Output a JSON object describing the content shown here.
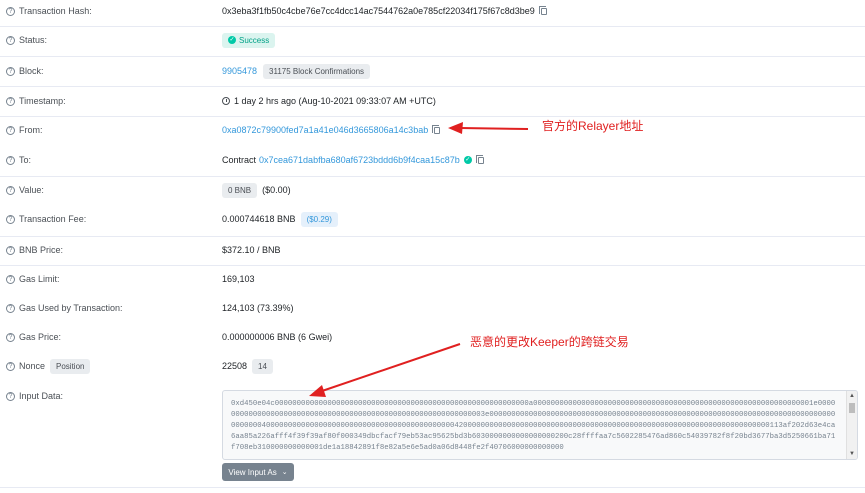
{
  "rows": {
    "hash": {
      "label": "Transaction Hash:",
      "value": "0x3eba3f1fb50c4cbe76e7cc4dcc14ac7544762a0e785cf22034f175f67c8d3be9"
    },
    "status": {
      "label": "Status:",
      "value": "Success"
    },
    "block": {
      "label": "Block:",
      "value": "9905478",
      "confirmations": "31175 Block Confirmations"
    },
    "timestamp": {
      "label": "Timestamp:",
      "value": "1 day 2 hrs ago (Aug-10-2021 09:33:07 AM +UTC)"
    },
    "from": {
      "label": "From:",
      "value": "0xa0872c79900fed7a1a41e046d3665806a14c3bab"
    },
    "to": {
      "label": "To:",
      "prefix": "Contract",
      "value": "0x7cea671dabfba680af6723bddd6b9f4caa15c87b"
    },
    "value": {
      "label": "Value:",
      "chip": "0 BNB",
      "usd": "($0.00)"
    },
    "fee": {
      "label": "Transaction Fee:",
      "value": "0.000744618 BNB",
      "usd": "($0.29)"
    },
    "price": {
      "label": "BNB Price:",
      "value": "$372.10 / BNB"
    },
    "gaslimit": {
      "label": "Gas Limit:",
      "value": "169,103"
    },
    "gasused": {
      "label": "Gas Used by Transaction:",
      "value": "124,103 (73.39%)"
    },
    "gasprice": {
      "label": "Gas Price:",
      "value": "0.000000006 BNB (6 Gwei)"
    },
    "nonce": {
      "label": "Nonce",
      "position": "Position",
      "value": "22508",
      "pos_value": "14"
    },
    "input": {
      "label": "Input Data:",
      "value": "0xd450e04c0000000000000000000000000000000000000000000000000000000000a0000000000000000000000000000000000000000000000000000000000000001e00000000000000000000000000000000000000000000000000000000000003e0000000000000000000000000000000000000000000000000000000000000000000000000000000000000040000000000000000000000000000000000000000000420000000000000000000000000000000000000000000000000000000000000000000000113af202d63e4ca6aa85a226afff4f39f39af80f000349dbcfacf79eb53ac95625bd3b6030000000000000000200c28ffffaa7c5602285476ad860c54039782f8f20bd3677ba3d5250661ba71f708eb310000000000001de1a18842891f8e82a5e6e5ad0a06d8448fe2f40706000000000000",
      "button": "View Input As"
    }
  },
  "annotations": {
    "from_note": "官方的Relayer地址",
    "input_note": "恶意的更改Keeper的跨链交易"
  },
  "icons": [
    "question-circle-icon",
    "copy-icon",
    "check-circle-icon",
    "clock-icon",
    "chevron-down-icon"
  ],
  "colors": {
    "link": "#3498db",
    "success": "#00c9a7",
    "annotation": "#e02020"
  }
}
